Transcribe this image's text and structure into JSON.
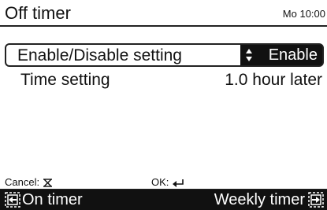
{
  "header": {
    "title": "Off timer",
    "clock": "Mo 10:00"
  },
  "settings": [
    {
      "label": "Enable/Disable setting",
      "value": "Enable",
      "selected": true
    },
    {
      "label": "Time setting",
      "value": "1.0 hour later",
      "selected": false
    }
  ],
  "hints": {
    "cancel_label": "Cancel:",
    "cancel_icon": "cancel-x-icon",
    "ok_label": "OK:",
    "ok_icon": "enter-arrow-icon"
  },
  "footer": {
    "left_label": "On timer",
    "left_icon": "nav-left-icon",
    "right_label": "Weekly timer",
    "right_icon": "nav-right-icon"
  }
}
